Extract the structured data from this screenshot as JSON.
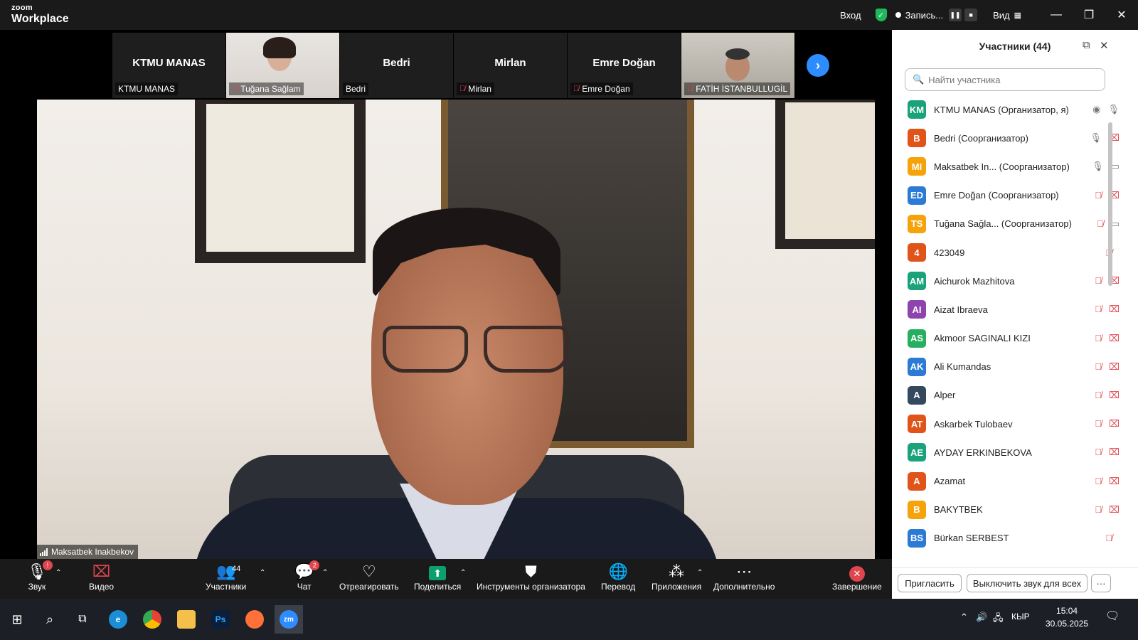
{
  "app": {
    "logo_small": "zoom",
    "logo_big": "Workplace"
  },
  "titlebar": {
    "signin": "Вход",
    "recording": "Запись...",
    "view": "Вид",
    "minimize": "—",
    "maximize": "❐",
    "close": "✕"
  },
  "filmstrip": [
    {
      "center": "KTMU MANAS",
      "label": "KTMU MANAS",
      "muted": false,
      "video": false
    },
    {
      "center": "",
      "label": "Tuğana Sağlam",
      "muted": true,
      "video": true
    },
    {
      "center": "Bedri",
      "label": "Bedri",
      "muted": false,
      "video": false
    },
    {
      "center": "Mirlan",
      "label": "Mirlan",
      "muted": true,
      "video": false
    },
    {
      "center": "Emre Doğan",
      "label": "Emre Doğan",
      "muted": true,
      "video": false
    },
    {
      "center": "",
      "label": "FATİH İSTANBULLUGİL",
      "muted": true,
      "video": true
    }
  ],
  "main_video": {
    "speaker": "Maksatbek Inakbekov"
  },
  "toolbar": {
    "audio": "Звук",
    "audio_badge": "!",
    "video": "Видео",
    "participants": "Участники",
    "participants_count": "44",
    "chat": "Чат",
    "chat_badge": "2",
    "react": "Отреагировать",
    "share": "Поделиться",
    "host_tools": "Инструменты организатора",
    "translate": "Перевод",
    "apps": "Приложения",
    "more": "Дополнительно",
    "end": "Завершение"
  },
  "panel": {
    "title": "Участники (44)",
    "search_placeholder": "Найти участника",
    "invite": "Пригласить",
    "mute_all": "Выключить звук для всех",
    "more": "···",
    "participants": [
      {
        "initials": "KM",
        "name": "KTMU MANAS (Организатор, я)",
        "color": "#1aa37a",
        "mic": "on",
        "cam": "rec"
      },
      {
        "initials": "B",
        "name": "Bedri (Соорганизатор)",
        "color": "#e0541a",
        "mic": "on",
        "cam": "off"
      },
      {
        "initials": "MI",
        "name": "Maksatbek In... (Соорганизатор)",
        "color": "#f5a30a",
        "mic": "live",
        "cam": "on"
      },
      {
        "initials": "ED",
        "name": "Emre Doğan (Соорганизатор)",
        "color": "#2b7bd6",
        "mic": "off",
        "cam": "off"
      },
      {
        "initials": "TS",
        "name": "Tuğana Sağla... (Соорганизатор)",
        "color": "#f5a30a",
        "mic": "off",
        "cam": "on"
      },
      {
        "initials": "4",
        "name": "423049",
        "color": "#e0541a",
        "mic": "off",
        "cam": "none"
      },
      {
        "initials": "AM",
        "name": "Aichurok Mazhitova",
        "color": "#1aa37a",
        "mic": "off",
        "cam": "off"
      },
      {
        "initials": "AI",
        "name": "Aizat Ibraeva",
        "color": "#8e44ad",
        "mic": "off",
        "cam": "off"
      },
      {
        "initials": "AS",
        "name": "Akmoor SAGINALI KIZI",
        "color": "#27ae60",
        "mic": "off",
        "cam": "off"
      },
      {
        "initials": "AK",
        "name": "Ali Kumandas",
        "color": "#2b7bd6",
        "mic": "off",
        "cam": "off"
      },
      {
        "initials": "A",
        "name": "Alper",
        "color": "#34495e",
        "mic": "off",
        "cam": "off"
      },
      {
        "initials": "AT",
        "name": "Askarbek Tulobaev",
        "color": "#e0541a",
        "mic": "off",
        "cam": "off"
      },
      {
        "initials": "AE",
        "name": "AYDAY ERKINBEKOVA",
        "color": "#1aa37a",
        "mic": "off",
        "cam": "off"
      },
      {
        "initials": "A",
        "name": "Azamat",
        "color": "#e0541a",
        "mic": "off",
        "cam": "off"
      },
      {
        "initials": "B",
        "name": "BAKYTBEK",
        "color": "#f5a30a",
        "mic": "off",
        "cam": "off"
      },
      {
        "initials": "BS",
        "name": "Bürkan SERBEST",
        "color": "#2b7bd6",
        "mic": "off",
        "cam": "none"
      }
    ]
  },
  "taskbar": {
    "time": "15:04",
    "date": "30.05.2025",
    "lang": "КЫР"
  }
}
